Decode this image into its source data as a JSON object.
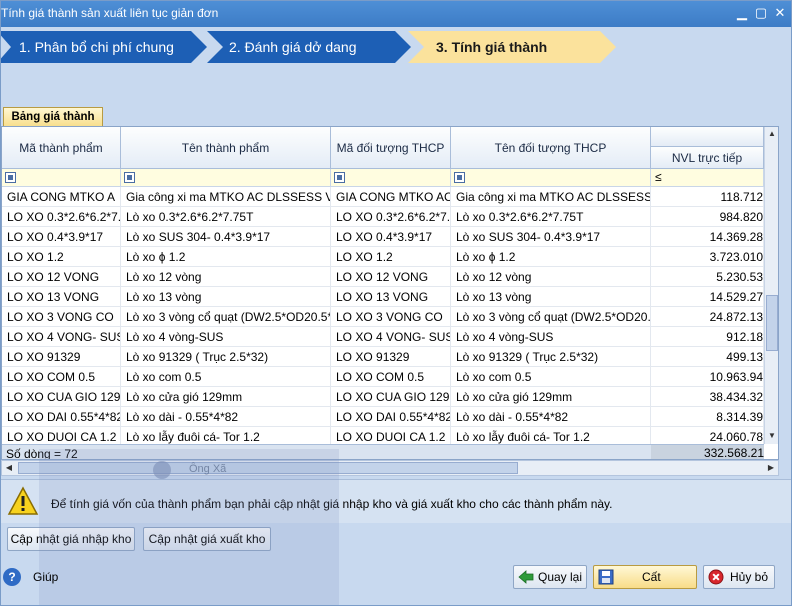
{
  "window": {
    "title": "Tính giá thành sản xuất liên tục giản đơn",
    "min_icon": "minimize-icon",
    "max_icon": "maximize-icon",
    "close_icon": "close-icon"
  },
  "steps": [
    {
      "label": "1. Phân bổ chi phí chung",
      "state": "done"
    },
    {
      "label": "2. Đánh giá dở dang",
      "state": "done"
    },
    {
      "label": "3. Tính giá thành",
      "state": "active"
    }
  ],
  "tab": {
    "label": "Bảng giá thành"
  },
  "grid": {
    "columns": [
      "Mã thành phẩm",
      "Tên thành phẩm",
      "Mã đối tượng THCP",
      "Tên đối tượng THCP",
      "NVL trực tiếp"
    ],
    "filter_operator": "≤",
    "rows": [
      [
        "GIA CONG MTKO A",
        "Gia công xi ma MTKO AC DLSSESS V",
        "GIA CONG MTKO AC",
        "Gia công xi ma MTKO AC DLSSESS",
        "118.712"
      ],
      [
        "LO XO 0.3*2.6*6.2*7.",
        "Lò xo 0.3*2.6*6.2*7.75T",
        "LO XO 0.3*2.6*6.2*7.",
        "Lò xo 0.3*2.6*6.2*7.75T",
        "984.820"
      ],
      [
        "LO XO 0.4*3.9*17",
        "Lò xo SUS 304- 0.4*3.9*17",
        "LO XO 0.4*3.9*17",
        "Lò xo SUS 304- 0.4*3.9*17",
        "14.369.28"
      ],
      [
        "LO XO 1.2",
        "Lò xo ϕ 1.2",
        "LO XO 1.2",
        "Lò xo ϕ 1.2",
        "3.723.010"
      ],
      [
        "LO XO 12 VONG",
        "Lò xo 12 vòng",
        "LO XO 12 VONG",
        "Lò xo 12 vòng",
        "5.230.53"
      ],
      [
        "LO XO 13 VONG",
        "Lò xo 13 vòng",
        "LO XO 13 VONG",
        "Lò xo 13 vòng",
        "14.529.27"
      ],
      [
        "LO XO 3 VONG CO",
        "Lò xo 3 vòng cổ quạt (DW2.5*OD20.5*L",
        "LO XO 3 VONG CO",
        "Lò xo 3 vòng cổ quạt (DW2.5*OD20.5",
        "24.872.13"
      ],
      [
        "LO XO 4 VONG- SUS",
        "Lò xo 4 vòng-SUS",
        "LO XO 4 VONG- SUS",
        "Lò xo 4 vòng-SUS",
        "912.18"
      ],
      [
        "LO XO 91329",
        "Lò xo 91329 ( Trục 2.5*32)",
        "LO XO 91329",
        "Lò xo 91329 ( Trục 2.5*32)",
        "499.13"
      ],
      [
        "LO XO COM 0.5",
        "Lò xo com 0.5",
        "LO XO COM 0.5",
        "Lò xo com 0.5",
        "10.963.94"
      ],
      [
        "LO XO CUA GIO 129",
        "Lò xo cửa gió 129mm",
        "LO XO CUA GIO 129",
        "Lò xo cửa gió 129mm",
        "38.434.32"
      ],
      [
        "LO XO DAI 0.55*4*82",
        "Lò xo dài - 0.55*4*82",
        "LO XO DAI 0.55*4*82",
        "Lò xo dài - 0.55*4*82",
        "8.314.39"
      ],
      [
        "LO XO DUOI CA 1.2",
        "Lò xo lẫy đuôi cá- Tor 1.2",
        "LO XO DUOI CA 1.2",
        "Lò xo lẫy đuôi cá- Tor 1.2",
        "24.060.78"
      ]
    ],
    "row_count_label": "Số dòng = 72",
    "total": "332.568.21"
  },
  "notice": {
    "message": "Để tính giá vốn của thành phẩm bạn phải cập nhật giá nhập kho và giá xuất kho cho các thành phẩm này.",
    "icon": "warning-icon"
  },
  "buttons": {
    "update_import_price": "Cập nhật giá nhập kho",
    "update_export_price": "Cập nhật giá xuất kho",
    "help": "Giúp",
    "back": "Quay lại",
    "save": "Cất",
    "cancel": "Hủy bỏ"
  },
  "background_window": {
    "title": "Ông Xã"
  },
  "colors": {
    "title_bar": "#3d7cc6",
    "step_done": "#1d5fb5",
    "step_active": "#fbe29c",
    "save_button": "#f8dc88"
  }
}
